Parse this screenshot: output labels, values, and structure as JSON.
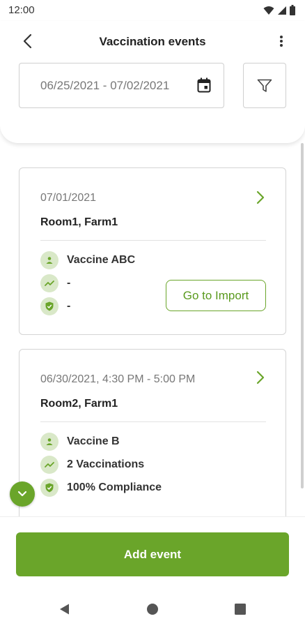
{
  "status_bar": {
    "time": "12:00"
  },
  "header": {
    "title": "Vaccination events"
  },
  "filter": {
    "date_range": "06/25/2021 - 07/02/2021"
  },
  "events": [
    {
      "date": "07/01/2021",
      "location": "Room1, Farm1",
      "vaccine": "Vaccine ABC",
      "vaccinations": "-",
      "compliance": "-",
      "import_label": "Go to Import"
    },
    {
      "date": "06/30/2021, 4:30 PM - 5:00 PM",
      "location": "Room2, Farm1",
      "vaccine": "Vaccine B",
      "vaccinations": "2 Vaccinations",
      "compliance": "100% Compliance"
    }
  ],
  "actions": {
    "add_event_label": "Add event"
  },
  "colors": {
    "accent": "#6aa52a",
    "icon_bg": "#d9e8c8"
  }
}
